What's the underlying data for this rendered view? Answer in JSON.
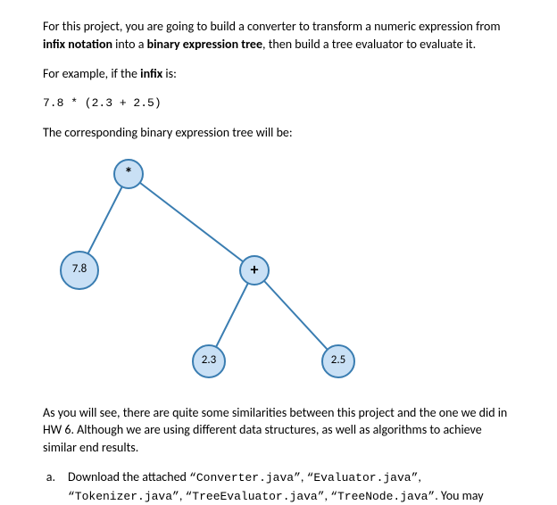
{
  "intro": {
    "segments": {
      "a": "For this project, you are going to build a converter to transform a numeric expression from ",
      "b": "infix notation",
      "c": " into a ",
      "d": "binary expression tree",
      "e": ", then build a tree evaluator to evaluate it."
    }
  },
  "example_label": {
    "a": "For example, if the ",
    "b": "infix",
    "c": " is:"
  },
  "infix_expr": "7.8 * (2.3 + 2.5)",
  "tree_intro": "The corresponding binary expression tree will be:",
  "tree": {
    "root": "*",
    "left": "7.8",
    "right_op": "+",
    "right_left": "2.3",
    "right_right": "2.5"
  },
  "followup": "As you will see, there are quite some similarities between this project and the one we did in HW 6. Although we are using different data structures, as well as algorithms to achieve similar end results.",
  "item_a": {
    "marker": "a.",
    "text1": "Download the attached ",
    "f1": "“Converter.java”",
    "sep1": ", ",
    "f2": "“Evaluator.java”",
    "sep2": ", ",
    "f3": "“Tokenizer.java”",
    "sep3": ", ",
    "f4": "“TreeEvaluator.java”",
    "sep4": ", ",
    "f5": "“TreeNode.java”",
    "text2": ". You may"
  }
}
